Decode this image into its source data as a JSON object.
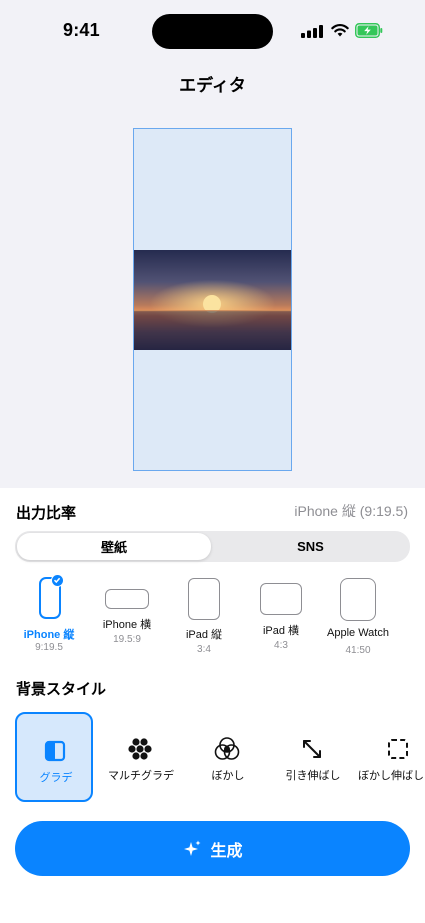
{
  "status_bar": {
    "time": "9:41"
  },
  "nav": {
    "title": "エディタ"
  },
  "output_ratio": {
    "label": "出力比率",
    "value": "iPhone 縦 (9:19.5)"
  },
  "tabs": [
    {
      "label": "壁紙",
      "selected": true
    },
    {
      "label": "SNS",
      "selected": false
    }
  ],
  "devices": [
    {
      "name": "iPhone 縦",
      "ratio": "9:19.5",
      "selected": true
    },
    {
      "name": "iPhone 横",
      "ratio": "19.5:9",
      "selected": false
    },
    {
      "name": "iPad 縦",
      "ratio": "3:4",
      "selected": false
    },
    {
      "name": "iPad 横",
      "ratio": "4:3",
      "selected": false
    },
    {
      "name": "Apple Watch",
      "ratio": "41:50",
      "selected": false
    }
  ],
  "background_style": {
    "label": "背景スタイル",
    "items": [
      {
        "label": "グラデ",
        "icon": "gradient-icon",
        "selected": true
      },
      {
        "label": "マルチグラデ",
        "icon": "multi-gradient-icon",
        "selected": false
      },
      {
        "label": "ぼかし",
        "icon": "blur-icon",
        "selected": false
      },
      {
        "label": "引き伸ばし",
        "icon": "stretch-icon",
        "selected": false
      },
      {
        "label": "ぼかし伸ばし",
        "icon": "blur-stretch-icon",
        "selected": false
      }
    ]
  },
  "generate": {
    "label": "生成",
    "icon": "sparkles-icon"
  },
  "colors": {
    "accent": "#0a84ff",
    "preview_bg": "#dde9f7",
    "selected_bg": "#d6e8fc"
  }
}
